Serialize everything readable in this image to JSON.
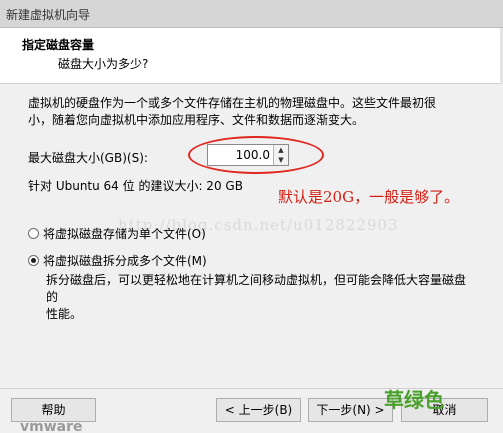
{
  "window": {
    "title": "新建虚拟机向导"
  },
  "header": {
    "title": "指定磁盘容量",
    "subtitle": "磁盘大小为多少?"
  },
  "description": [
    "虚拟机的硬盘作为一个或多个文件存储在主机的物理磁盘中。这些文件最初很",
    "小，随着您向虚拟机中添加应用程序、文件和数据而逐渐变大。"
  ],
  "disk_size": {
    "label": "最大磁盘大小(GB)(S):",
    "value": "100.0"
  },
  "recommendation": "针对 Ubuntu 64 位 的建议大小: 20 GB",
  "annotation": {
    "note": "默认是20G，一般是够了。",
    "watermark": "http://blog.csdn.net/u012822903",
    "ellipse_color": "#e0281e"
  },
  "options": {
    "single_file": {
      "label": "将虚拟磁盘存储为单个文件(O)",
      "selected": false
    },
    "split_files": {
      "label": "将虚拟磁盘拆分成多个文件(M)",
      "selected": true,
      "description": [
        "拆分磁盘后，可以更轻松地在计算机之间移动虚拟机，但可能会降低大容量磁盘的",
        "性能。"
      ]
    }
  },
  "buttons": {
    "help": "帮助",
    "back": "< 上一步(B)",
    "next": "下一步(N) >",
    "cancel": "取消"
  },
  "brand": {
    "text": "草绿色",
    "color": "#4aa02c"
  },
  "vmware_logo": "vmware"
}
